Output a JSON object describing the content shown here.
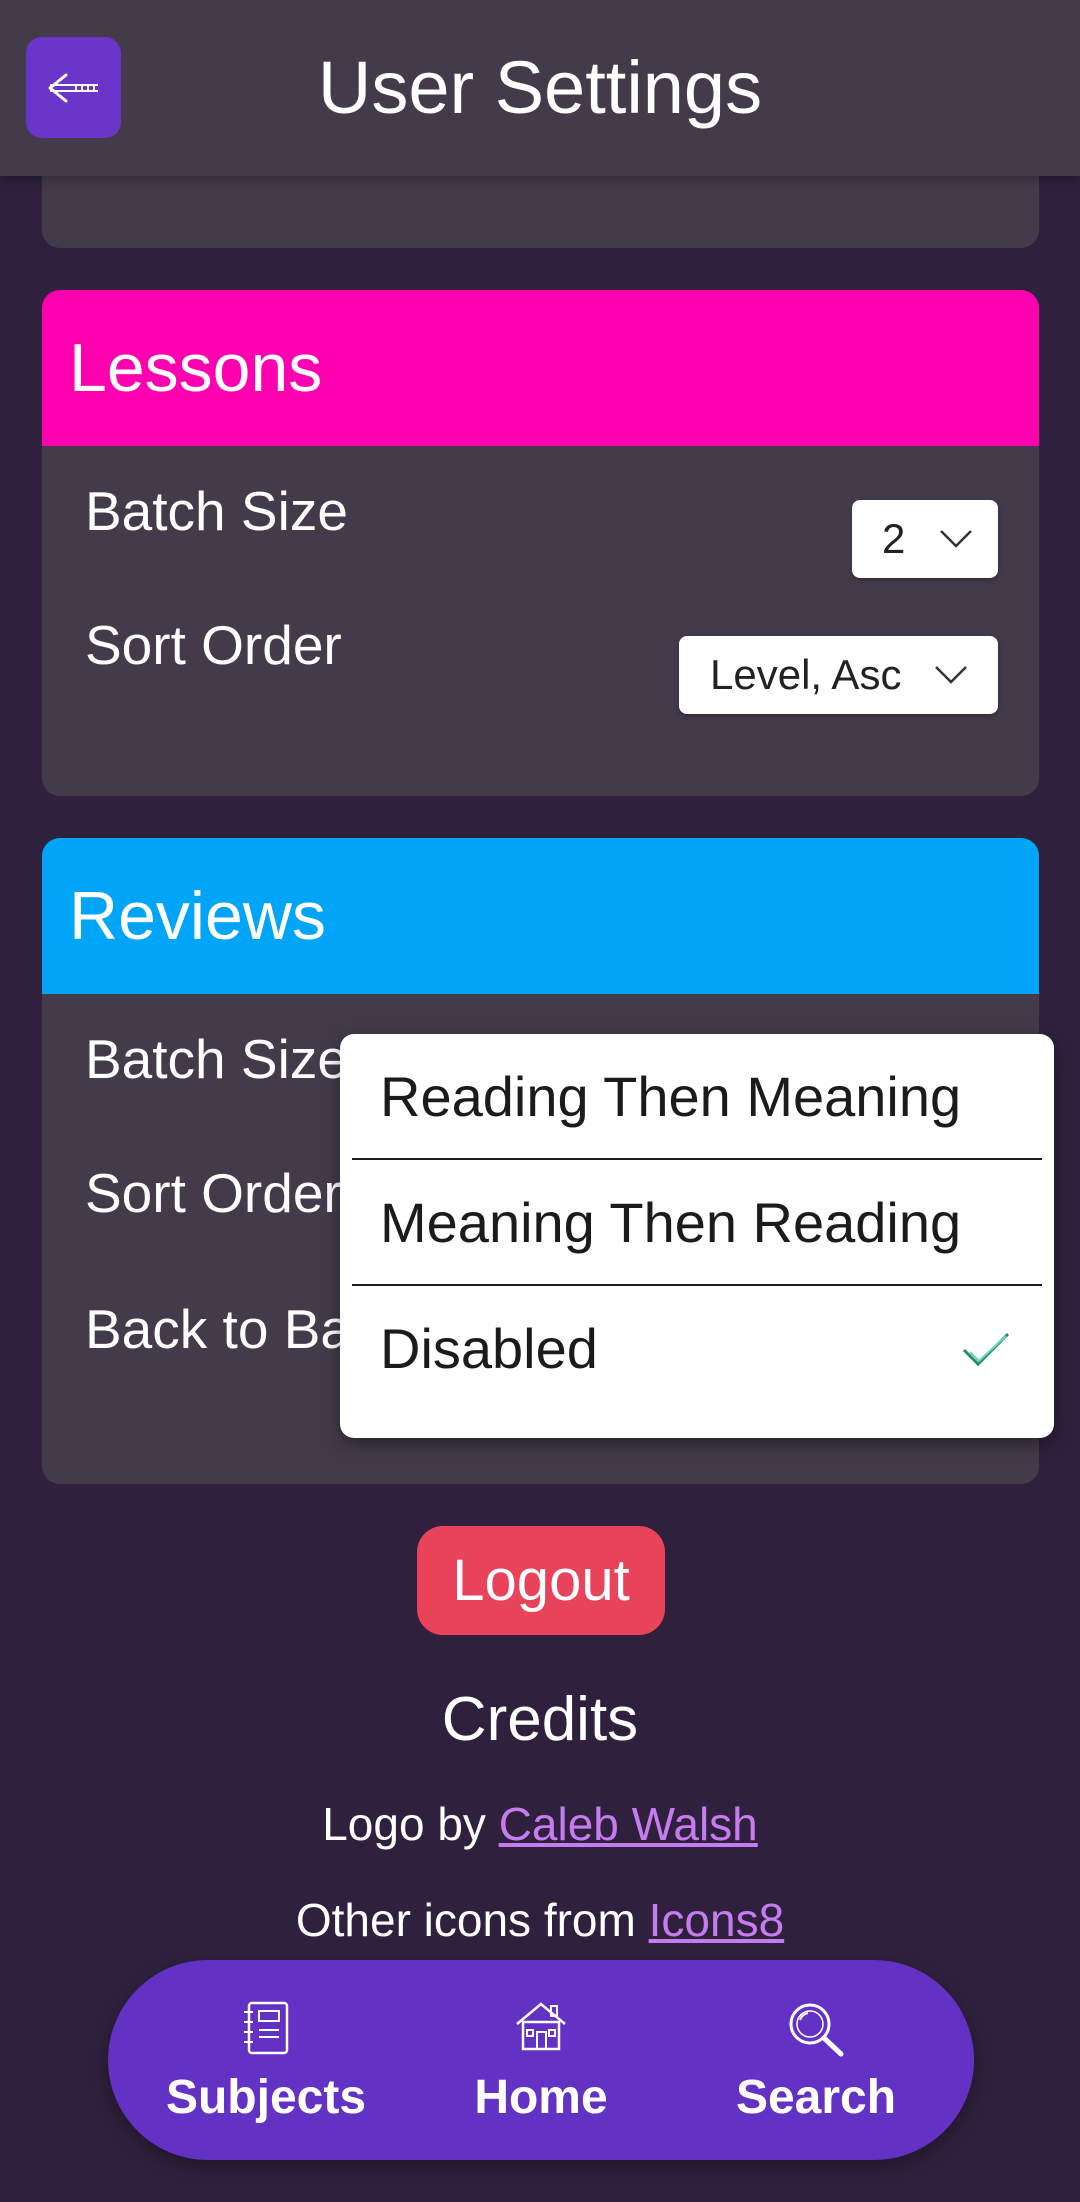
{
  "header": {
    "title": "User Settings",
    "back_icon": "back-arrow-icon"
  },
  "lessons": {
    "title": "Lessons",
    "color": "#ff00b0",
    "batch_size_label": "Batch Size",
    "batch_size_value": "2",
    "sort_order_label": "Sort Order",
    "sort_order_value": "Level, Asc"
  },
  "reviews": {
    "title": "Reviews",
    "color": "#00a5f8",
    "batch_size_label": "Batch Size",
    "sort_order_label": "Sort Order",
    "back_to_back_label": "Back to Back"
  },
  "dropdown": {
    "options": [
      {
        "label": "Reading Then Meaning",
        "selected": false
      },
      {
        "label": "Meaning Then Reading",
        "selected": false
      },
      {
        "label": "Disabled",
        "selected": true
      }
    ]
  },
  "logout_label": "Logout",
  "credits": {
    "title": "Credits",
    "logo_prefix": "Logo by ",
    "logo_author": "Caleb Walsh",
    "icons_prefix": "Other icons from ",
    "icons_source": "Icons8"
  },
  "nav": {
    "items": [
      {
        "label": "Subjects",
        "icon": "notebook-icon"
      },
      {
        "label": "Home",
        "icon": "home-icon"
      },
      {
        "label": "Search",
        "icon": "search-icon"
      }
    ]
  }
}
